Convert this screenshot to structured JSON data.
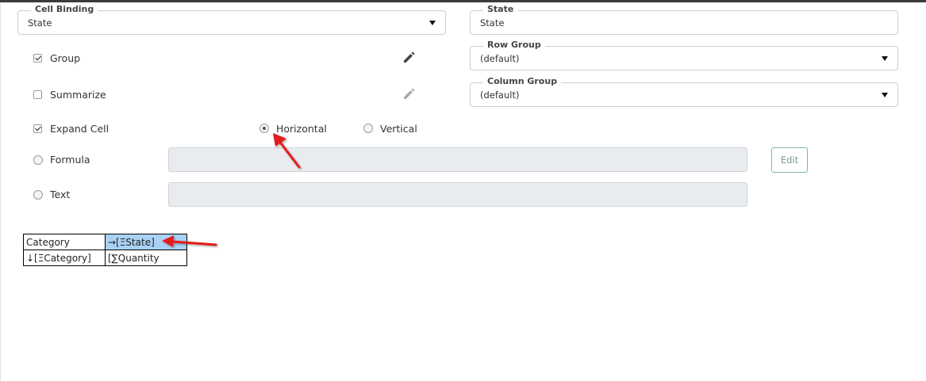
{
  "cell_binding": {
    "label": "Cell Binding",
    "value": "State"
  },
  "state_field": {
    "label": "State",
    "value": "State"
  },
  "row_group": {
    "label": "Row Group",
    "value": "(default)"
  },
  "column_group": {
    "label": "Column Group",
    "value": "(default)"
  },
  "options": {
    "group": {
      "label": "Group",
      "checked": true
    },
    "summarize": {
      "label": "Summarize",
      "checked": false
    },
    "expand_cell": {
      "label": "Expand Cell",
      "checked": true
    }
  },
  "direction": {
    "horizontal": {
      "label": "Horizontal",
      "selected": true
    },
    "vertical": {
      "label": "Vertical",
      "selected": false
    }
  },
  "formula": {
    "label": "Formula",
    "selected": false,
    "value": ""
  },
  "text": {
    "label": "Text",
    "selected": false,
    "value": ""
  },
  "edit_button": {
    "label": "Edit"
  },
  "preview_grid": {
    "rows": [
      [
        "Category",
        "→[ΞState]"
      ],
      [
        "↓[ΞCategory]",
        "[∑Quantity"
      ]
    ]
  },
  "colors": {
    "accent": "#80b3a8",
    "selected_cell": "#a9d2f5",
    "annotation_arrow": "#e31b1b"
  },
  "icons": [
    "pencil-icon",
    "chevron-down-icon",
    "annotation-arrow"
  ]
}
